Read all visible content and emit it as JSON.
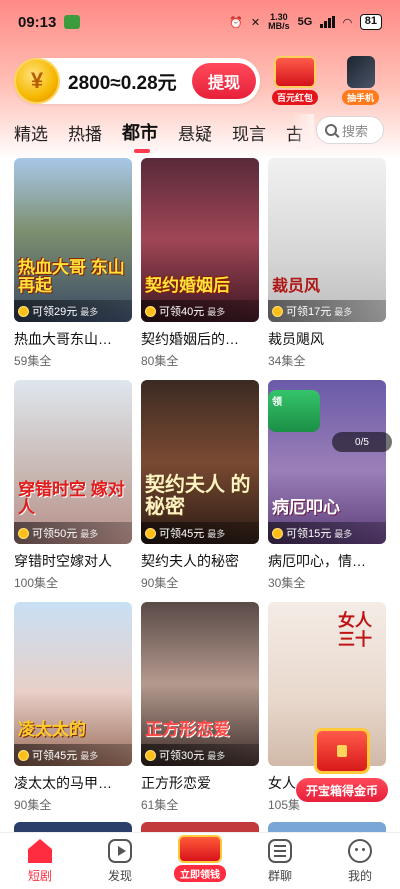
{
  "status_bar": {
    "time": "09:13",
    "net_speed": "1.30",
    "net_unit": "MB/s",
    "network": "5G",
    "battery": "81"
  },
  "coin_banner": {
    "coin_symbol": "¥",
    "balance_text": "2800≈0.28元",
    "withdraw_label": "提现"
  },
  "promos": [
    {
      "label": "百元红包"
    },
    {
      "label": "抽手机"
    }
  ],
  "tabs": [
    {
      "label": "精选",
      "active": false
    },
    {
      "label": "热播",
      "active": false
    },
    {
      "label": "都市",
      "active": true
    },
    {
      "label": "悬疑",
      "active": false
    },
    {
      "label": "现言",
      "active": false
    },
    {
      "label": "古",
      "active": false
    }
  ],
  "search": {
    "placeholder": "搜索"
  },
  "dramas": [
    {
      "title": "热血大哥东山…",
      "episodes": "59集全",
      "poster_text": "热血大哥 东山再起",
      "reward": "可领29元",
      "reward_suffix": "最多"
    },
    {
      "title": "契约婚姻后的…",
      "episodes": "80集全",
      "poster_text": "契约婚姻后",
      "reward": "可领40元",
      "reward_suffix": "最多"
    },
    {
      "title": "裁员飓风",
      "episodes": "34集全",
      "poster_text": "裁员风",
      "reward": "可领17元",
      "reward_suffix": "最多"
    },
    {
      "title": "穿错时空嫁对人",
      "episodes": "100集全",
      "poster_text": "穿错时空 嫁对人",
      "reward": "可领50元",
      "reward_suffix": "最多"
    },
    {
      "title": "契约夫人的秘密",
      "episodes": "90集全",
      "poster_text": "契约夫人 的秘密",
      "reward": "可领45元",
      "reward_suffix": "最多"
    },
    {
      "title": "病厄叩心，情…",
      "episodes": "30集全",
      "poster_text": "病厄叩心",
      "reward": "可领15元",
      "reward_suffix": "最多"
    },
    {
      "title": "凌太太的马甲…",
      "episodes": "90集全",
      "poster_text": "凌太太的",
      "reward": "可领45元",
      "reward_suffix": "最多"
    },
    {
      "title": "正方形恋爱",
      "episodes": "61集全",
      "poster_text": "正方形恋爱",
      "reward": "可领30元",
      "reward_suffix": "最多"
    },
    {
      "title": "女人…",
      "episodes": "105集",
      "poster_text": "女人 三十",
      "reward": "",
      "reward_suffix": ""
    }
  ],
  "widgets": {
    "progress_badge": "领",
    "progress_text": "0/5",
    "treasure_label": "开宝箱得金币"
  },
  "bottom_nav": [
    {
      "label": "短剧",
      "icon": "home-icon",
      "active": true
    },
    {
      "label": "发现",
      "icon": "discover-icon",
      "active": false
    },
    {
      "label": "立即领钱",
      "icon": "red-envelope-icon",
      "active": false
    },
    {
      "label": "群聊",
      "icon": "group-chat-icon",
      "active": false
    },
    {
      "label": "我的",
      "icon": "profile-icon",
      "active": false
    }
  ],
  "colors": {
    "accent": "#ff2d3f",
    "header_gradient_top": "#ff8a85"
  }
}
